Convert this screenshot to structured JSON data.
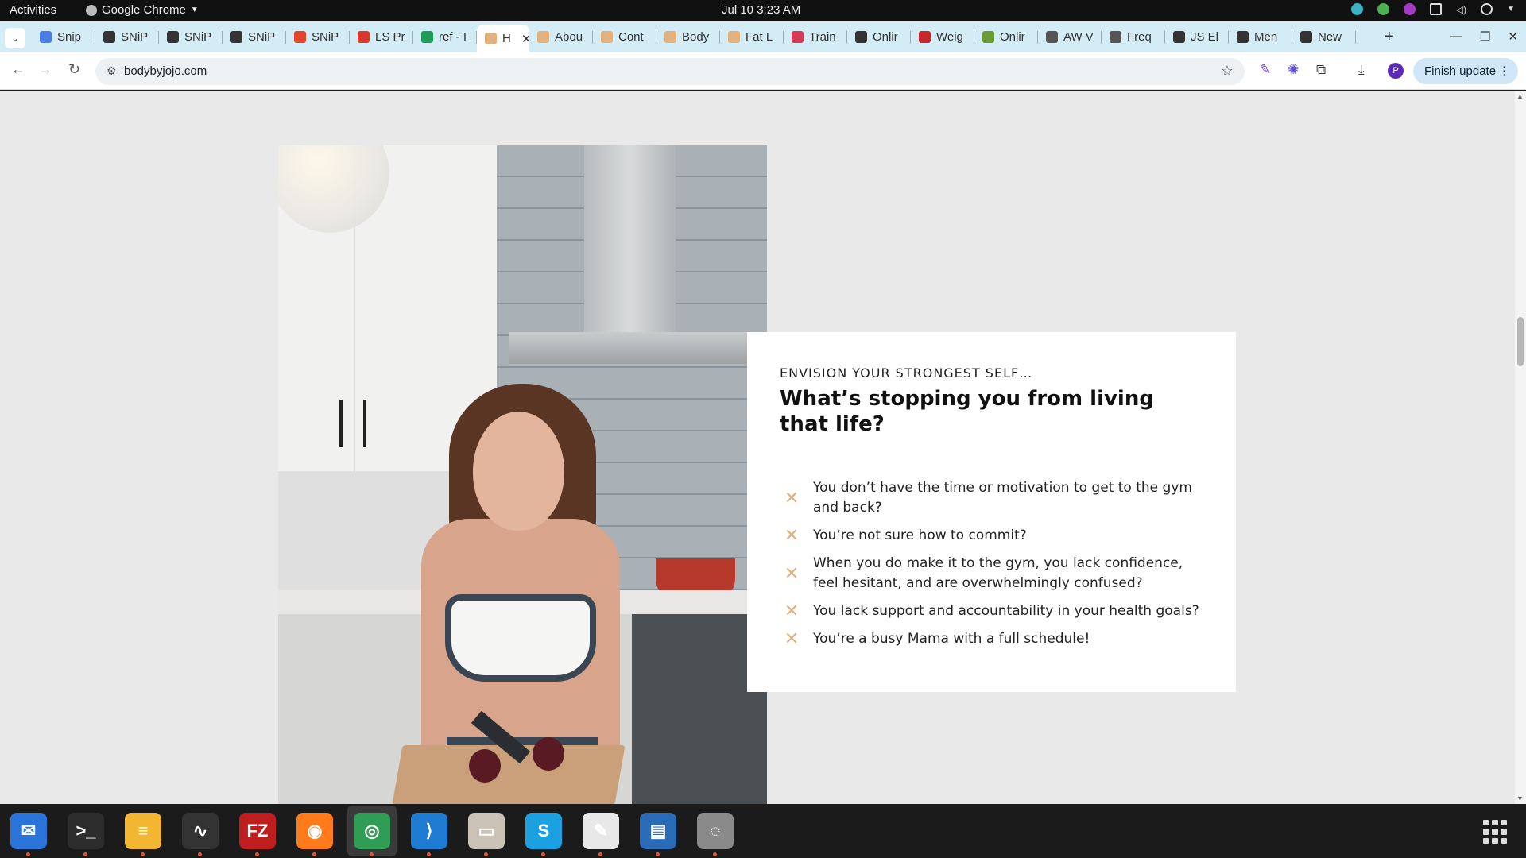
{
  "topbar": {
    "activities": "Activities",
    "app_name": "Google Chrome",
    "clock": "Jul 10  3:23 AM"
  },
  "tabs": [
    {
      "label": "Snip",
      "icon": "docs-icon",
      "color": "#4a7de8"
    },
    {
      "label": "SNiP",
      "icon": "snip-icon",
      "color": "#333333"
    },
    {
      "label": "SNiP",
      "icon": "snip-icon",
      "color": "#333333"
    },
    {
      "label": "SNiP",
      "icon": "snip-icon",
      "color": "#333333"
    },
    {
      "label": "SNiP",
      "icon": "snip-red-icon",
      "color": "#e2462a"
    },
    {
      "label": "LS Pr",
      "icon": "ls-icon",
      "color": "#d7382c"
    },
    {
      "label": "ref - I",
      "icon": "sheets-icon",
      "color": "#1e9c55"
    },
    {
      "label": "H",
      "icon": "jojo-icon",
      "color": "#e2b17e",
      "active": true
    },
    {
      "label": "Abou",
      "icon": "jojo-icon",
      "color": "#e2b17e"
    },
    {
      "label": "Cont",
      "icon": "jojo-icon",
      "color": "#e2b17e"
    },
    {
      "label": "Body",
      "icon": "jojo-icon",
      "color": "#e2b17e"
    },
    {
      "label": "Fat L",
      "icon": "jojo-icon",
      "color": "#e2b17e"
    },
    {
      "label": "Train",
      "icon": "heart-icon",
      "color": "#d53b55"
    },
    {
      "label": "Onlir",
      "icon": "person-icon",
      "color": "#333333"
    },
    {
      "label": "Weig",
      "icon": "person-red-icon",
      "color": "#c7282e"
    },
    {
      "label": "Onlir",
      "icon": "image-icon",
      "color": "#6b9c34"
    },
    {
      "label": "AW V",
      "icon": "image-icon",
      "color": "#555555"
    },
    {
      "label": "Freq",
      "icon": "image-icon",
      "color": "#555555"
    },
    {
      "label": "JS El",
      "icon": "shield-icon",
      "color": "#333333"
    },
    {
      "label": "Men",
      "icon": "shield-icon",
      "color": "#333333"
    },
    {
      "label": "New",
      "icon": "globe-icon",
      "color": "#333333"
    }
  ],
  "toolbar": {
    "url": "bodybyjojo.com",
    "profile_initial": "P",
    "finish_update": "Finish update"
  },
  "card": {
    "eyebrow": "ENVISION YOUR STRONGEST SELF…",
    "heading": "What’s stopping you from living that life?",
    "bullets": [
      "You don’t have the time or motivation to get to the gym and back?",
      "You’re not sure how to commit?",
      "When you do make it to the gym, you lack confidence, feel hesitant, and are overwhelmingly confused?",
      "You lack support and accountability in your health goals?",
      "You’re a busy Mama with a full schedule!"
    ],
    "bullet_icon": "x-mark-icon",
    "accent_color": "#e2b17e"
  },
  "dock": [
    {
      "name": "thunderbird",
      "color": "#2a73d9",
      "glyph": "✉"
    },
    {
      "name": "terminal",
      "color": "#2d2d2d",
      "glyph": ">_"
    },
    {
      "name": "notes",
      "color": "#f2b632",
      "glyph": "≡"
    },
    {
      "name": "system-monitor",
      "color": "#333333",
      "glyph": "∿"
    },
    {
      "name": "filezilla",
      "color": "#bf1e1e",
      "glyph": "FZ"
    },
    {
      "name": "firefox",
      "color": "#ff7a1a",
      "glyph": "◉"
    },
    {
      "name": "chrome",
      "color": "#2f9e54",
      "glyph": "◎"
    },
    {
      "name": "vscode",
      "color": "#1f7ad1",
      "glyph": "⟩"
    },
    {
      "name": "files",
      "color": "#c9c2b5",
      "glyph": "▭"
    },
    {
      "name": "skype",
      "color": "#1ba1e2",
      "glyph": "S"
    },
    {
      "name": "text-editor",
      "color": "#e8e8e8",
      "glyph": "✎"
    },
    {
      "name": "writer",
      "color": "#2a6bb8",
      "glyph": "▤"
    },
    {
      "name": "disc",
      "color": "#8a8a8a",
      "glyph": "◌"
    }
  ]
}
